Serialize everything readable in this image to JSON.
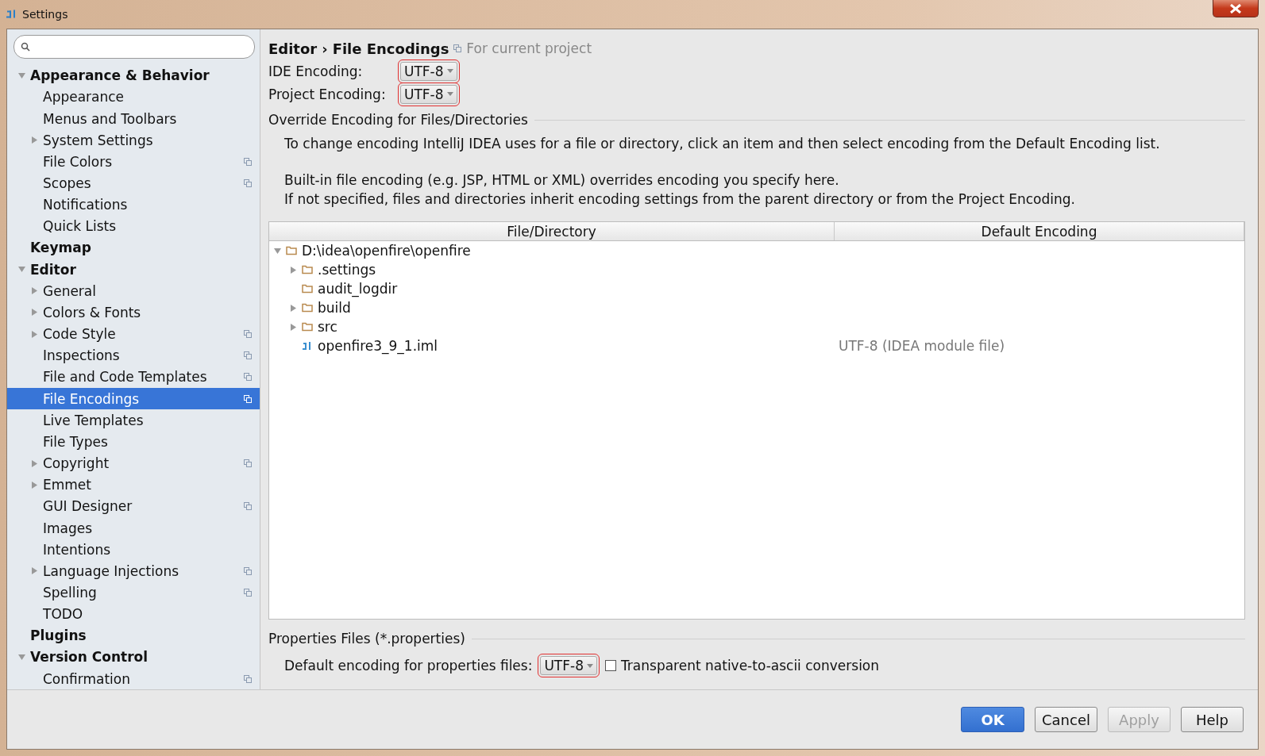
{
  "window": {
    "title": "Settings"
  },
  "sidebar": {
    "items": [
      {
        "label": "Appearance & Behavior",
        "bold": true,
        "expanded": true,
        "selected": false,
        "children": [
          {
            "label": "Appearance",
            "selected": false
          },
          {
            "label": "Menus and Toolbars",
            "selected": false
          },
          {
            "label": "System Settings",
            "expanded": false,
            "selected": false
          },
          {
            "label": "File Colors",
            "project": true,
            "selected": false
          },
          {
            "label": "Scopes",
            "project": true,
            "selected": false
          },
          {
            "label": "Notifications",
            "selected": false
          },
          {
            "label": "Quick Lists",
            "selected": false
          }
        ]
      },
      {
        "label": "Keymap",
        "bold": true,
        "selected": false
      },
      {
        "label": "Editor",
        "bold": true,
        "expanded": true,
        "selected": false,
        "children": [
          {
            "label": "General",
            "expanded": false,
            "selected": false
          },
          {
            "label": "Colors & Fonts",
            "expanded": false,
            "selected": false
          },
          {
            "label": "Code Style",
            "expanded": false,
            "project": true,
            "selected": false
          },
          {
            "label": "Inspections",
            "project": true,
            "selected": false
          },
          {
            "label": "File and Code Templates",
            "project": true,
            "selected": false
          },
          {
            "label": "File Encodings",
            "project": true,
            "selected": true
          },
          {
            "label": "Live Templates",
            "selected": false
          },
          {
            "label": "File Types",
            "selected": false
          },
          {
            "label": "Copyright",
            "expanded": false,
            "project": true,
            "selected": false
          },
          {
            "label": "Emmet",
            "expanded": false,
            "selected": false
          },
          {
            "label": "GUI Designer",
            "project": true,
            "selected": false
          },
          {
            "label": "Images",
            "selected": false
          },
          {
            "label": "Intentions",
            "selected": false
          },
          {
            "label": "Language Injections",
            "expanded": false,
            "project": true,
            "selected": false
          },
          {
            "label": "Spelling",
            "project": true,
            "selected": false
          },
          {
            "label": "TODO",
            "selected": false
          }
        ]
      },
      {
        "label": "Plugins",
        "bold": true,
        "selected": false
      },
      {
        "label": "Version Control",
        "bold": true,
        "expanded": true,
        "selected": false,
        "children": [
          {
            "label": "Confirmation",
            "project": true,
            "selected": false
          }
        ]
      }
    ]
  },
  "breadcrumb": {
    "parent": "Editor",
    "separator": "›",
    "current": "File Encodings",
    "scope": "For current project"
  },
  "encodings": [
    {
      "label": "IDE Encoding:",
      "value": "UTF-8"
    },
    {
      "label": "Project Encoding:",
      "value": "UTF-8"
    }
  ],
  "override": {
    "title": "Override Encoding for Files/Directories",
    "notes": [
      "To change encoding IntelliJ IDEA uses for a file or directory, click an item and then select encoding from the Default Encoding list.",
      "Built-in file encoding (e.g. JSP, HTML or XML) overrides encoding you specify here.",
      "If not specified, files and directories inherit encoding settings from the parent directory or from the Project Encoding."
    ],
    "table": {
      "columns": [
        "File/Directory",
        "Default Encoding"
      ],
      "rows": [
        {
          "name": "D:\\idea\\openfire\\openfire",
          "kind": "folder",
          "expanded": true,
          "children": [
            {
              "name": ".settings",
              "kind": "folder",
              "expanded": false
            },
            {
              "name": "audit_logdir",
              "kind": "folder"
            },
            {
              "name": "build",
              "kind": "folder",
              "expanded": false
            },
            {
              "name": "src",
              "kind": "folder",
              "expanded": false
            },
            {
              "name": "openfire3_9_1.iml",
              "kind": "module",
              "encoding": "UTF-8 (IDEA module file)"
            }
          ]
        }
      ]
    }
  },
  "properties": {
    "title": "Properties Files (*.properties)",
    "label": "Default encoding for properties files:",
    "value": "UTF-8",
    "checkbox": {
      "label": "Transparent native-to-ascii conversion",
      "checked": false
    }
  },
  "buttons": [
    {
      "label": "OK",
      "kind": "primary"
    },
    {
      "label": "Cancel",
      "kind": "normal"
    },
    {
      "label": "Apply",
      "kind": "disabled"
    },
    {
      "label": "Help",
      "kind": "normal"
    }
  ]
}
